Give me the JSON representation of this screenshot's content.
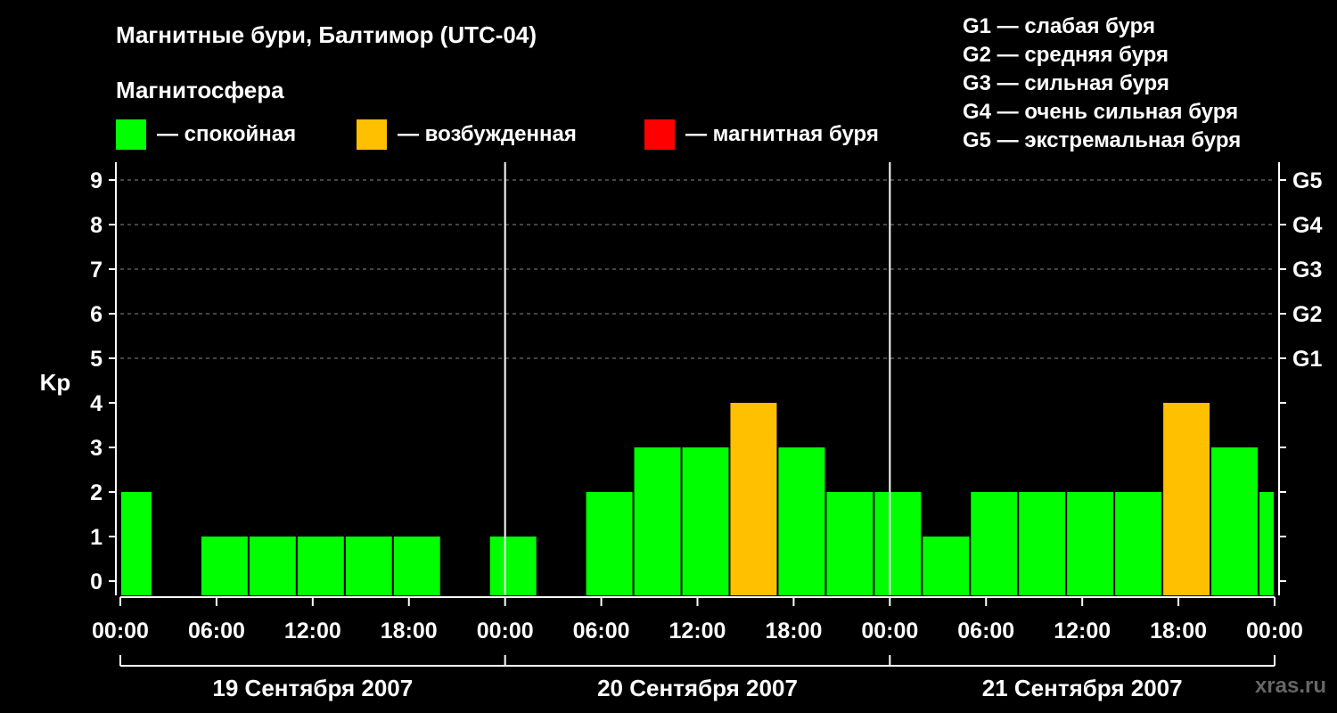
{
  "header": {
    "title": "Магнитные бури, Балтимор (UTC-04)",
    "subtitle": "Магнитосфера"
  },
  "legend": [
    {
      "label": "— спокойная",
      "color": "#00ff00"
    },
    {
      "label": "— возбужденная",
      "color": "#ffc000"
    },
    {
      "label": "— магнитная буря",
      "color": "#ff0000"
    }
  ],
  "g_scale": [
    "G1 — слабая буря",
    "G2 — средняя буря",
    "G3 — сильная буря",
    "G4 — очень сильная буря",
    "G5 — экстремальная буря"
  ],
  "watermark": "xras.ru",
  "chart_data": {
    "type": "bar",
    "ylabel": "Kp",
    "ylim": [
      0,
      9
    ],
    "y_ticks": [
      0,
      1,
      2,
      3,
      4,
      5,
      6,
      7,
      8,
      9
    ],
    "right_ticks": [
      {
        "value": 5,
        "label": "G1"
      },
      {
        "value": 6,
        "label": "G2"
      },
      {
        "value": 7,
        "label": "G3"
      },
      {
        "value": 8,
        "label": "G4"
      },
      {
        "value": 9,
        "label": "G5"
      }
    ],
    "x_ticks": [
      "00:00",
      "06:00",
      "12:00",
      "18:00",
      "00:00",
      "06:00",
      "12:00",
      "18:00",
      "00:00",
      "06:00",
      "12:00",
      "18:00",
      "00:00"
    ],
    "x_range_hours": [
      0,
      72
    ],
    "days": [
      "19 Сентября 2007",
      "20 Сентября 2007",
      "21 Сентября 2007"
    ],
    "grid": "dashed at Kp 5-9",
    "bars": [
      {
        "start": 0,
        "end": 2,
        "kp": 2,
        "level": "quiet"
      },
      {
        "start": 2,
        "end": 5,
        "kp": 0,
        "level": "quiet"
      },
      {
        "start": 5,
        "end": 8,
        "kp": 1,
        "level": "quiet"
      },
      {
        "start": 8,
        "end": 11,
        "kp": 1,
        "level": "quiet"
      },
      {
        "start": 11,
        "end": 14,
        "kp": 1,
        "level": "quiet"
      },
      {
        "start": 14,
        "end": 17,
        "kp": 1,
        "level": "quiet"
      },
      {
        "start": 17,
        "end": 20,
        "kp": 1,
        "level": "quiet"
      },
      {
        "start": 20,
        "end": 23,
        "kp": 0,
        "level": "quiet"
      },
      {
        "start": 23,
        "end": 26,
        "kp": 1,
        "level": "quiet"
      },
      {
        "start": 26,
        "end": 29,
        "kp": 0,
        "level": "quiet"
      },
      {
        "start": 29,
        "end": 32,
        "kp": 2,
        "level": "quiet"
      },
      {
        "start": 32,
        "end": 35,
        "kp": 3,
        "level": "quiet"
      },
      {
        "start": 35,
        "end": 38,
        "kp": 3,
        "level": "quiet"
      },
      {
        "start": 38,
        "end": 41,
        "kp": 4,
        "level": "active"
      },
      {
        "start": 41,
        "end": 44,
        "kp": 3,
        "level": "quiet"
      },
      {
        "start": 44,
        "end": 47,
        "kp": 2,
        "level": "quiet"
      },
      {
        "start": 47,
        "end": 50,
        "kp": 2,
        "level": "quiet"
      },
      {
        "start": 50,
        "end": 53,
        "kp": 1,
        "level": "quiet"
      },
      {
        "start": 53,
        "end": 56,
        "kp": 2,
        "level": "quiet"
      },
      {
        "start": 56,
        "end": 59,
        "kp": 2,
        "level": "quiet"
      },
      {
        "start": 59,
        "end": 62,
        "kp": 2,
        "level": "quiet"
      },
      {
        "start": 62,
        "end": 65,
        "kp": 2,
        "level": "quiet"
      },
      {
        "start": 65,
        "end": 68,
        "kp": 4,
        "level": "active"
      },
      {
        "start": 68,
        "end": 71,
        "kp": 3,
        "level": "quiet"
      },
      {
        "start": 71,
        "end": 72,
        "kp": 2,
        "level": "quiet"
      }
    ],
    "colors": {
      "quiet": "#00ff00",
      "active": "#ffc000",
      "storm": "#ff0000"
    }
  }
}
